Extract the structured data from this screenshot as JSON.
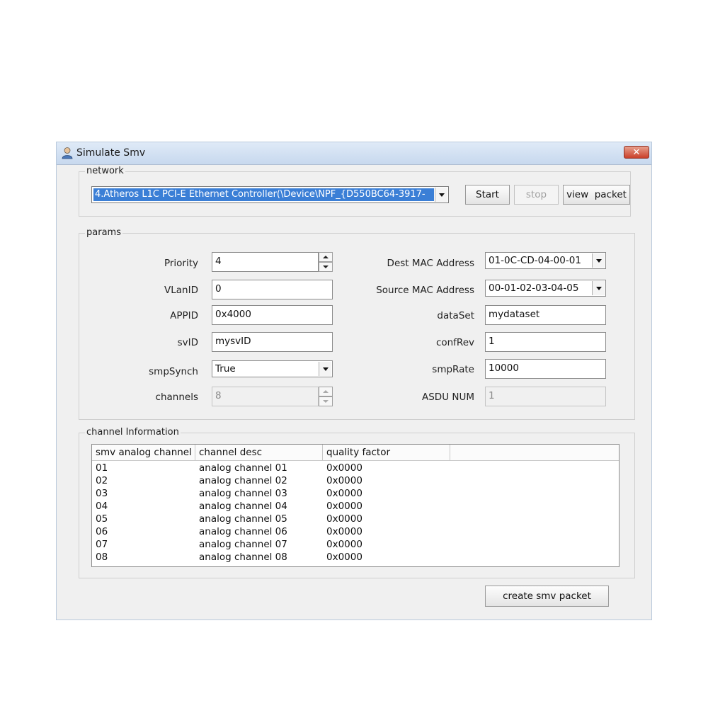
{
  "window": {
    "title": "Simulate Smv",
    "close_glyph": "✕"
  },
  "network": {
    "legend": "network",
    "adapter_selected": "4.Atheros L1C PCI-E Ethernet Controller(\\Device\\NPF_{D550BC64-3917-",
    "start_label": "Start",
    "stop_label": "stop",
    "view_packet_label": "view  packet"
  },
  "params": {
    "legend": "params",
    "priority": {
      "label": "Priority",
      "value": "4"
    },
    "vlanid": {
      "label": "VLanID",
      "value": "0"
    },
    "appid": {
      "label": "APPID",
      "value": "0x4000"
    },
    "svid": {
      "label": "svID",
      "value": "mysvID"
    },
    "smpsynch": {
      "label": "smpSynch",
      "value": "True"
    },
    "channels": {
      "label": "channels",
      "value": "8"
    },
    "dest_mac": {
      "label": "Dest MAC Address",
      "value": "01-0C-CD-04-00-01"
    },
    "source_mac": {
      "label": "Source MAC Address",
      "value": "00-01-02-03-04-05"
    },
    "dataset": {
      "label": "dataSet",
      "value": "mydataset"
    },
    "confrev": {
      "label": "confRev",
      "value": "1"
    },
    "smprate": {
      "label": "smpRate",
      "value": "10000"
    },
    "asdu_num": {
      "label": "ASDU NUM",
      "value": "1"
    }
  },
  "channel_info": {
    "legend": "channel Information",
    "columns": [
      "smv analog channel",
      "channel desc",
      "quality factor",
      ""
    ],
    "rows": [
      [
        "01",
        "analog channel 01",
        "0x0000"
      ],
      [
        "02",
        "analog channel 02",
        "0x0000"
      ],
      [
        "03",
        "analog channel 03",
        "0x0000"
      ],
      [
        "04",
        "analog channel 04",
        "0x0000"
      ],
      [
        "05",
        "analog channel 05",
        "0x0000"
      ],
      [
        "06",
        "analog channel 06",
        "0x0000"
      ],
      [
        "07",
        "analog channel 07",
        "0x0000"
      ],
      [
        "08",
        "analog channel 08",
        "0x0000"
      ]
    ]
  },
  "footer": {
    "create_label": "create smv packet"
  }
}
